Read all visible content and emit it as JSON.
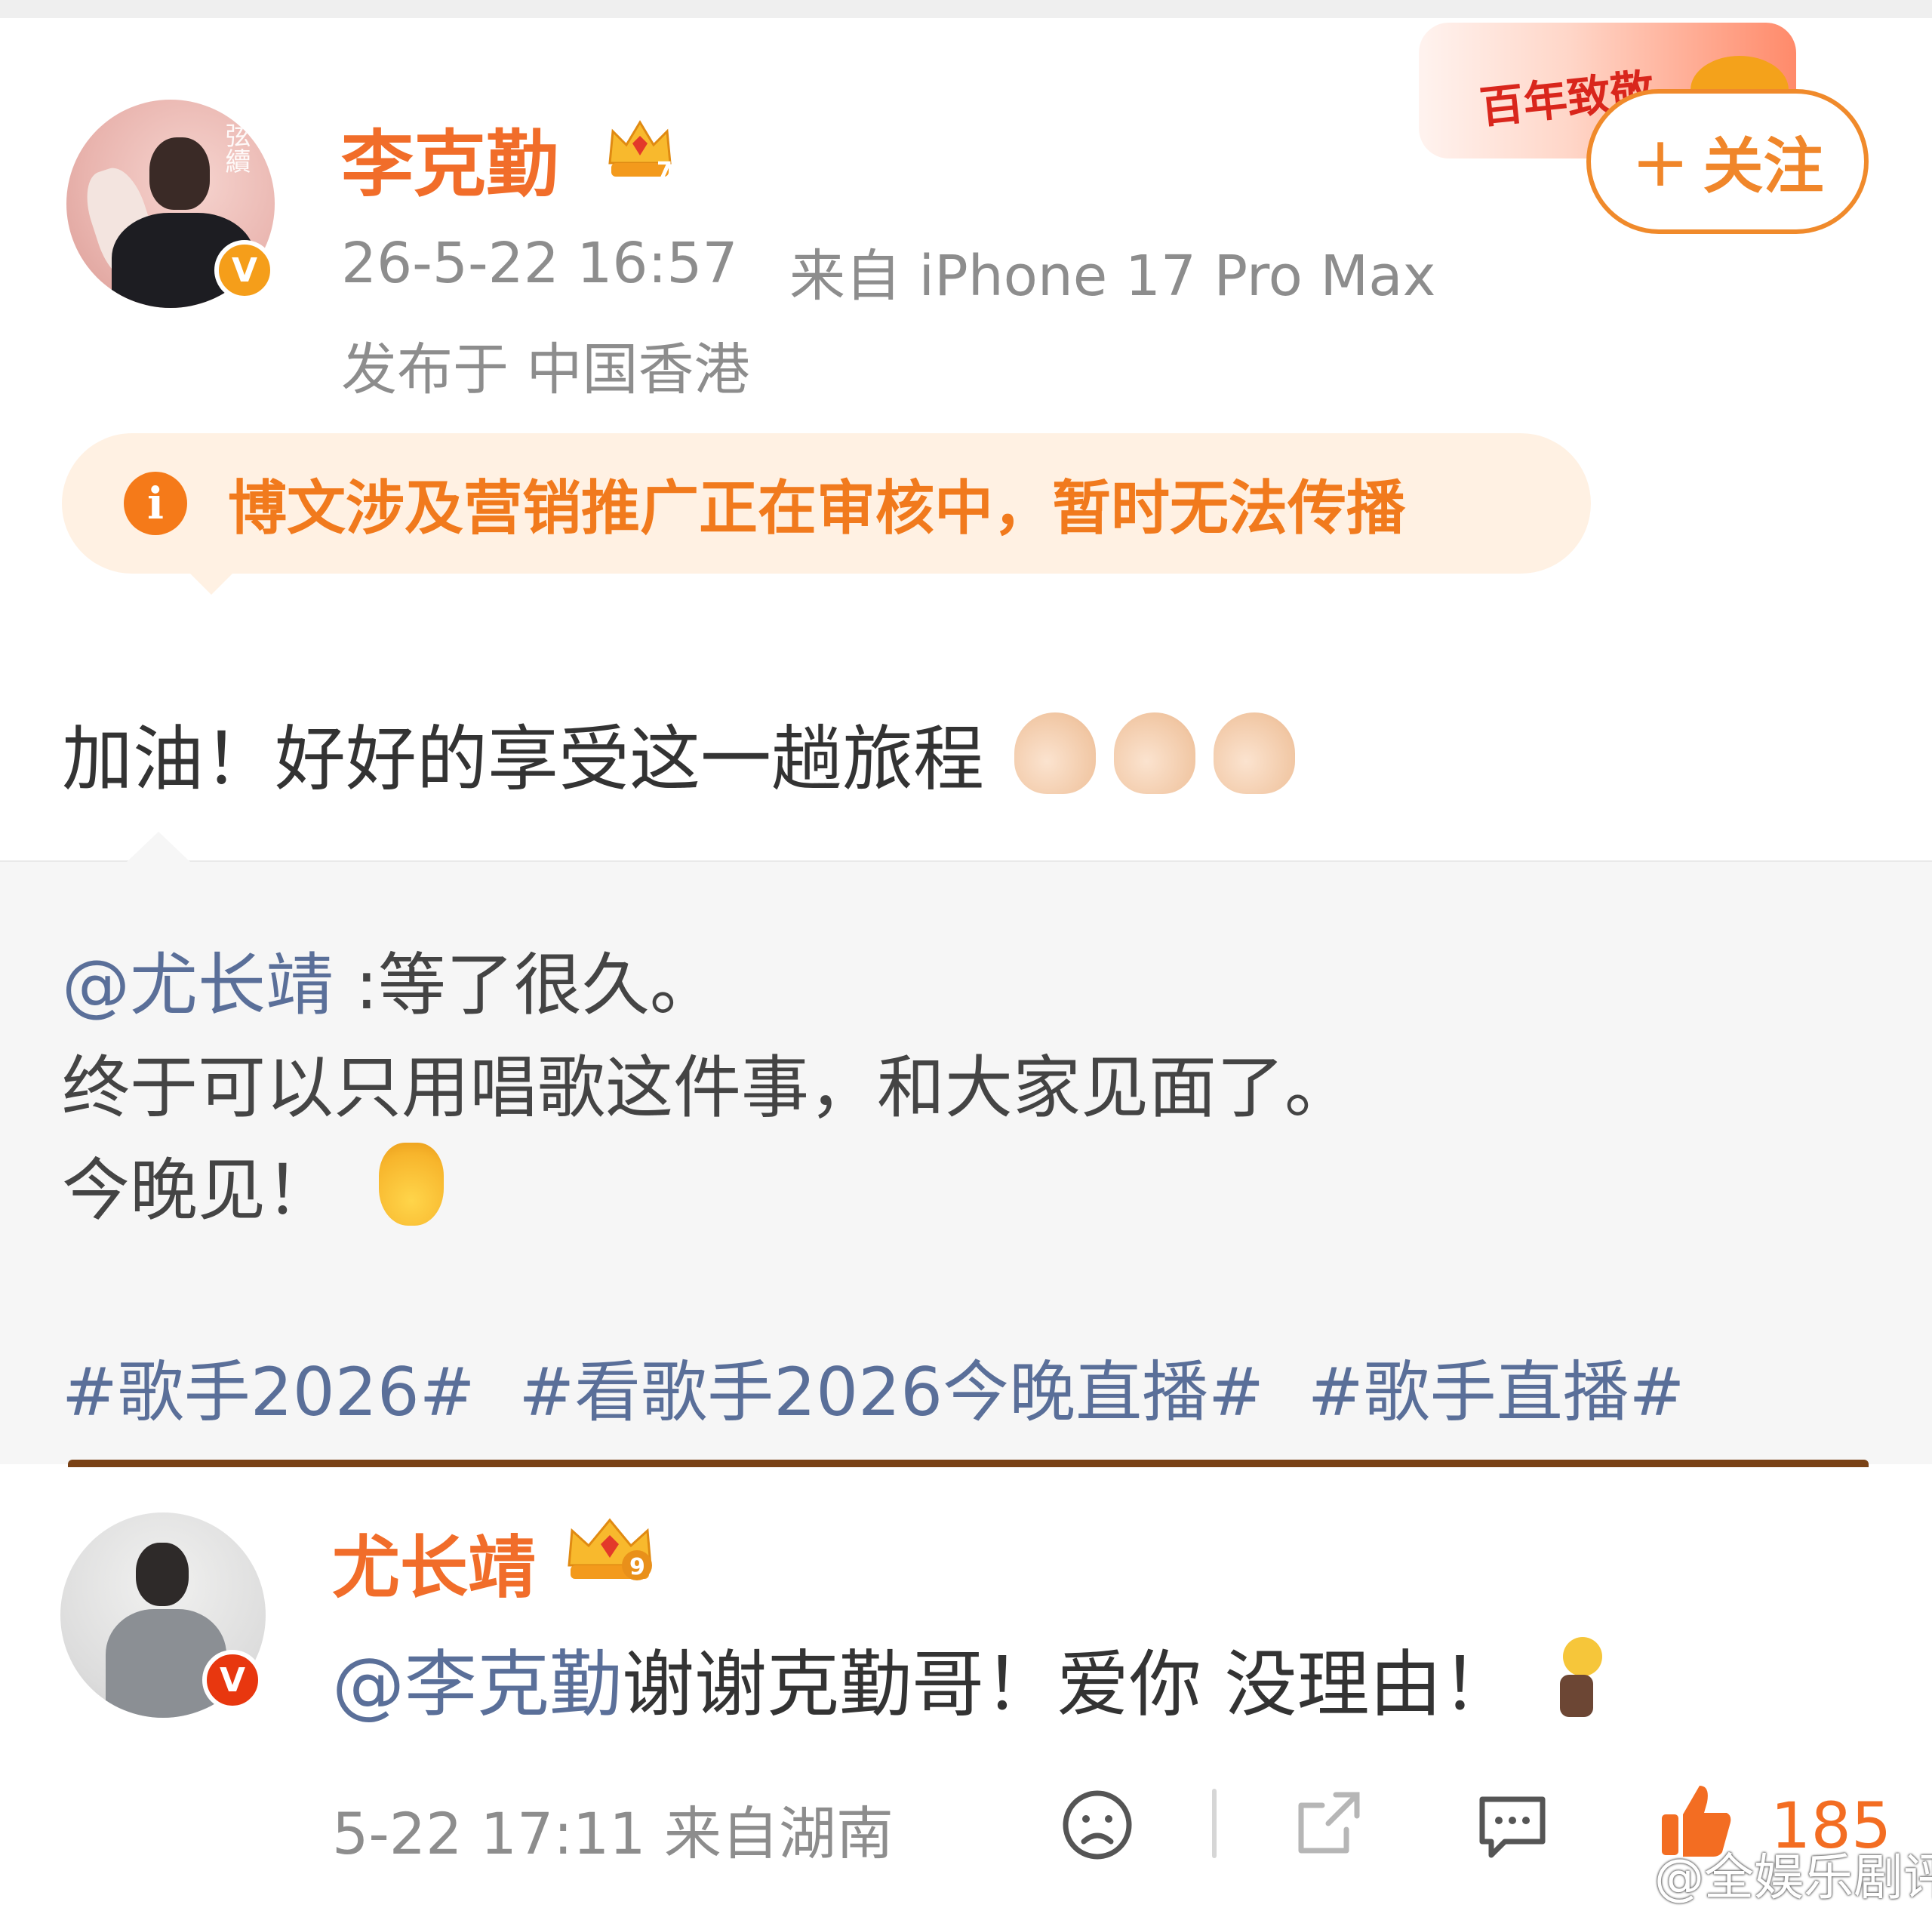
{
  "post": {
    "author": {
      "name": "李克勤",
      "verified_badge": "V",
      "avatar_text": "弦續"
    },
    "time": "26-5-22 16:57",
    "source": "来自 iPhone 17 Pro Max",
    "location": "发布于 中国香港",
    "follow_label": "关注",
    "promo_text": "百年致敬",
    "notice": {
      "icon": "i",
      "text": "博文涉及营销推广正在审核中，暂时无法传播"
    },
    "text": "加油！好好的享受这一趟旅程",
    "emojis": [
      "flexed-biceps",
      "flexed-biceps",
      "flexed-biceps"
    ]
  },
  "repost": {
    "mention": "@尤长靖",
    "line1_rest": " :等了很久。",
    "line2": "终于可以只用唱歌这件事，和大家见面了。",
    "line3": "今晚见！",
    "tags": [
      "#歌手2026#",
      "#看歌手2026今晚直播#",
      "#歌手直播#"
    ]
  },
  "reply": {
    "author": {
      "name": "尤长靖",
      "verified_badge": "V",
      "crown_level": "9"
    },
    "mention": "@李克勤",
    "text": " 谢谢克勤哥！爱你 没理由！",
    "time_source": "5-22 17:11  来自湖南",
    "like_count": "185"
  },
  "crown_level_author": "7",
  "watermark": "@全娱乐剧评",
  "colors": {
    "accent_orange": "#f16d2a",
    "link_blue": "#5a6f99",
    "meta_gray": "#8d8d8d",
    "notice_bg": "#fff1e3"
  }
}
